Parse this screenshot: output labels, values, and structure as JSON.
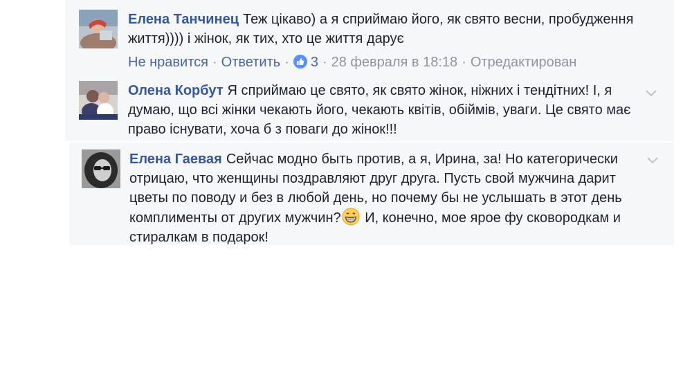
{
  "comments": [
    {
      "author": "Елена Танчинец",
      "text": "Теж цікаво) а я сприймаю його, як свято весни, пробудження життя)))) і жінок, як тих, хто це життя дарує",
      "actions": {
        "dislike": "Не нравится",
        "reply": "Ответить",
        "likes": "3",
        "date": "28 февраля в 18:18",
        "edited": "Отредактирован"
      }
    },
    {
      "author": "Олена Корбут",
      "text": "Я сприймаю це свято, як свято жінок, ніжних і тендітних! І, я думаю, що всі жінки чекають його, чекають квітів, обіймів, уваги. Це свято має право існувати, хоча б з поваги до жінок!!!"
    },
    {
      "author": "Елена Гаевая",
      "text_part1": "Сейчас модно быть против, а я, Ирина, за! Но категорически отрицаю, что женщины поздравляют друг друга. Пусть свой мужчина дарит цветы по поводу и без в любой день, но почему бы не услышать в этот день комплименты от других мужчин?",
      "emoji": "grinning-face",
      "text_part2": " И, конечно, мое ярое фу сковородкам и стиралкам в подарок!"
    }
  ],
  "colors": {
    "author": "#365899",
    "link": "#4b67a1",
    "meta": "#90949c",
    "text": "#1d2129",
    "background": "#f6f7f9"
  },
  "icons": [
    "like-thumb-icon",
    "chevron-down-icon",
    "grinning-face-emoji"
  ]
}
